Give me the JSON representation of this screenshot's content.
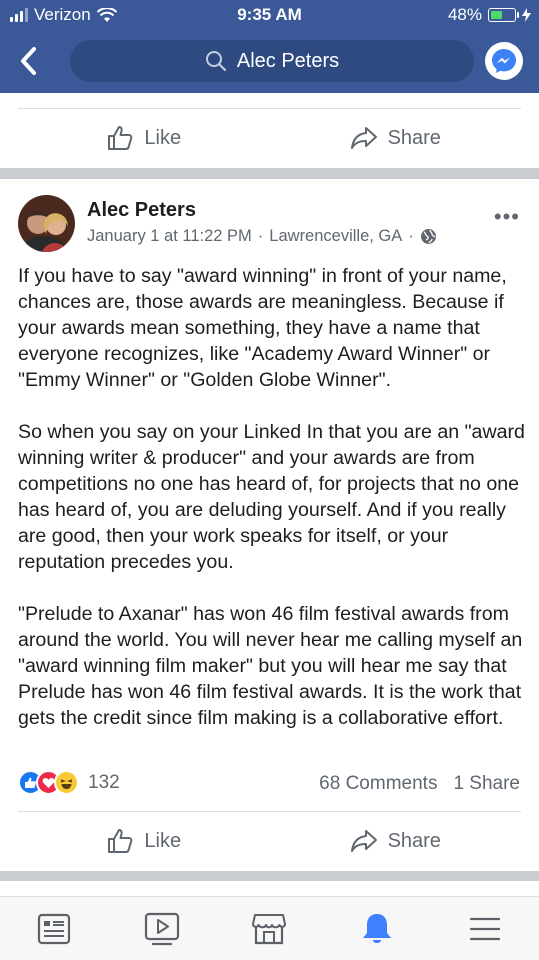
{
  "status_bar": {
    "carrier": "Verizon",
    "time": "9:35 AM",
    "battery": "48%"
  },
  "nav": {
    "search_text": "Alec Peters",
    "icons": [
      "back-chevron-icon",
      "search-icon",
      "messenger-icon"
    ]
  },
  "previous_post_actions": {
    "like_label": "Like",
    "share_label": "Share"
  },
  "post": {
    "author": "Alec Peters",
    "date": "January 1 at 11:22 PM",
    "location": "Lawrenceville, GA",
    "audience_icon": "globe-icon",
    "paragraphs": [
      "If you have to say \"award winning\" in front of your name, chances are, those awards are meaningless. Because if your awards mean something, they have a name that everyone recognizes, like \"Academy Award Winner\" or \"Emmy Winner\" or \"Golden Globe Winner\".",
      "So when you say on your Linked In that you are an \"award winning writer & producer\" and your awards are from competitions no one has heard of, for projects that no one has heard of, you are deluding yourself. And if you really are good, then your work speaks for itself, or your reputation precedes you.",
      "\"Prelude to Axanar\" has won 46 film festival awards from around the world. You will never hear me calling myself an \"award winning film maker\" but you will hear me say that Prelude has won 46 film festival awards. It is the work that gets the credit since film making is a collaborative effort."
    ],
    "reaction_icons": [
      "like-reaction-icon",
      "love-reaction-icon",
      "haha-reaction-icon"
    ],
    "reaction_count": "132",
    "comments": "68 Comments",
    "shares": "1 Share",
    "like_label": "Like",
    "share_label": "Share"
  },
  "tab_bar": [
    "news-feed-icon",
    "watch-icon",
    "marketplace-icon",
    "notifications-icon",
    "menu-icon"
  ],
  "colors": {
    "brand": "#3b5998",
    "active_tab": "#4080ff"
  }
}
